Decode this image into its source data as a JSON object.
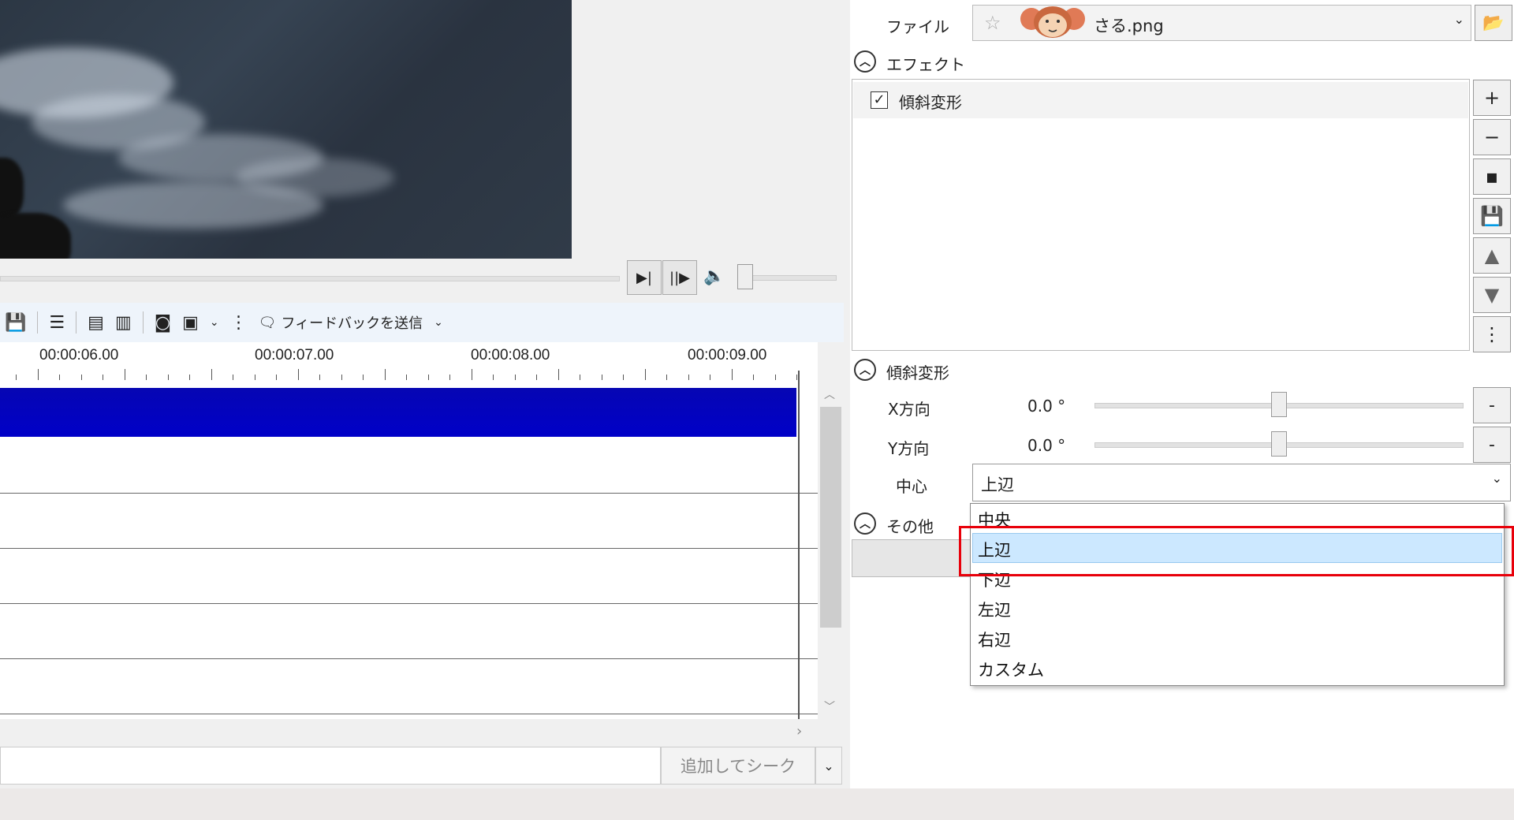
{
  "preview": {
    "description_icon": "video-frame"
  },
  "playback": {
    "frame_step_icon": "step-forward-icon",
    "play_icon": "play-pause-icon",
    "volume_icon": "speaker-icon"
  },
  "toolbar": {
    "feedback_label": "フィードバックを送信"
  },
  "ruler": {
    "labels": [
      "00:00:06.00",
      "00:00:07.00",
      "00:00:08.00",
      "00:00:09.00"
    ]
  },
  "seek": {
    "button_label": "追加してシーク"
  },
  "properties": {
    "file_label": "ファイル",
    "file_name": "さる.png",
    "effects_header": "エフェクト",
    "effects": [
      {
        "name": "傾斜変形",
        "checked": true
      }
    ],
    "skew_header": "傾斜変形",
    "x_label": "X方向",
    "x_value": "0.0 °",
    "y_label": "Y方向",
    "y_value": "0.0 °",
    "center_label": "中心",
    "center_value": "上辺",
    "other_header": "その他",
    "minus_label": "-"
  },
  "center_options": [
    "中央",
    "上辺",
    "下辺",
    "左辺",
    "右辺",
    "カスタム"
  ],
  "selected_option": "上辺",
  "colors": {
    "clip": "#0000c8",
    "highlight_border": "#e8000a",
    "option_highlight": "#cce8ff"
  }
}
